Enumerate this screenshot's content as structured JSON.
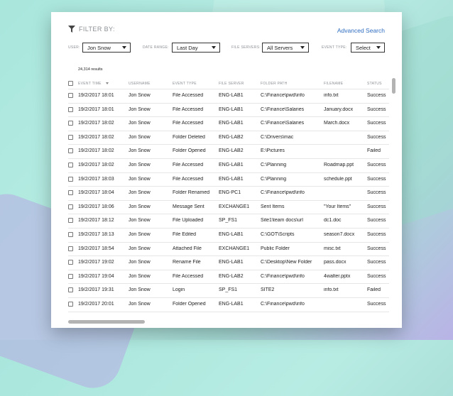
{
  "filter": {
    "title": "FILTER BY:",
    "advanced_search": "Advanced Search",
    "user_label": "USER:",
    "user_value": "Jon Snow",
    "date_label": "DATE RANGE:",
    "date_value": "Last Day",
    "servers_label": "FILE SERVERS:",
    "servers_value": "All Servers",
    "event_label": "EVENT TYPE:",
    "event_value": "Select"
  },
  "results_count": "24,314 results",
  "table": {
    "columns": [
      "EVENT TIME",
      "USERNAME",
      "EVENT TYPE",
      "FILE SERVER",
      "FOLDER PATH",
      "FILENAME",
      "STATUS"
    ],
    "rows": [
      [
        "19/2/2017 18:01",
        "Jon Snow",
        "File Accessed",
        "ENG-LAB1",
        "C:\\Finance\\pwd\\info",
        "info.txt",
        "Success"
      ],
      [
        "19/2/2017 18:01",
        "Jon Snow",
        "File Accessed",
        "ENG-LAB1",
        "C:\\Finance\\Salaries",
        "January.docx",
        "Success"
      ],
      [
        "19/2/2017 18:02",
        "Jon Snow",
        "File Accessed",
        "ENG-LAB1",
        "C:\\Finance\\Salaries",
        "March.docx",
        "Success"
      ],
      [
        "19/2/2017 18:02",
        "Jon Snow",
        "Folder Deleted",
        "ENG-LAB2",
        "C:\\Drivers\\mac",
        "",
        "Success"
      ],
      [
        "19/2/2017 18:02",
        "Jon Snow",
        "Folder Opened",
        "ENG-LAB2",
        "E:\\Pictures",
        "",
        "Failed"
      ],
      [
        "19/2/2017 18:02",
        "Jon Snow",
        "File Accessed",
        "ENG-LAB1",
        "C:\\Planning",
        "Roadmap.ppt",
        "Success"
      ],
      [
        "19/2/2017 18:03",
        "Jon Snow",
        "File Accessed",
        "ENG-LAB1",
        "C:\\Planning",
        "schedule.ppt",
        "Success"
      ],
      [
        "19/2/2017 18:04",
        "Jon Snow",
        "Folder Renamed",
        "ENG-PC1",
        "C:\\Finance\\pwd\\info",
        "",
        "Success"
      ],
      [
        "19/2/2017 18:06",
        "Jon Snow",
        "Message Sent",
        "EXCHANGE1",
        "Sent Items",
        "\"Your Items\"",
        "Success"
      ],
      [
        "19/2/2017 18:12",
        "Jon Snow",
        "File Uploaded",
        "SP_FS1",
        "Site1\\team docs\\url",
        "dc1.doc",
        "Success"
      ],
      [
        "19/2/2017 18:13",
        "Jon Snow",
        "File Edited",
        "ENG-LAB1",
        "C:\\GOT\\Scripts",
        "season7.docx",
        "Success"
      ],
      [
        "19/2/2017 18:54",
        "Jon Snow",
        "Attached File",
        "EXCHANGE1",
        "Public Folder",
        "misc.txt",
        "Success"
      ],
      [
        "19/2/2017 19:02",
        "Jon Snow",
        "Rename File",
        "ENG-LAB1",
        "C:\\Desktop\\New Folder",
        "pass.docx",
        "Success"
      ],
      [
        "19/2/2017 19:04",
        "Jon Snow",
        "File Accessed",
        "ENG-LAB2",
        "C:\\Finance\\pwd\\info",
        "4walter.pptx",
        "Success"
      ],
      [
        "19/2/2017 19:31",
        "Jon Snow",
        "Login",
        "SP_FS1",
        "SITE2",
        "info.txt",
        "Failed"
      ],
      [
        "19/2/2017 20:01",
        "Jon Snow",
        "Folder Opened",
        "ENG-LAB1",
        "C:\\Finance\\pwd\\info",
        "",
        "Success"
      ]
    ]
  }
}
